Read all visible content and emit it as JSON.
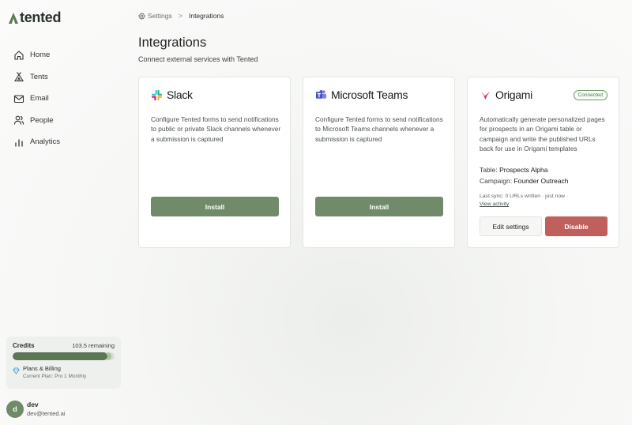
{
  "brand": {
    "name": "tented",
    "color": "#5c7756"
  },
  "nav": [
    {
      "label": "Home",
      "icon": "home-icon"
    },
    {
      "label": "Tents",
      "icon": "tent-icon"
    },
    {
      "label": "Email",
      "icon": "mail-icon"
    },
    {
      "label": "People",
      "icon": "people-icon"
    },
    {
      "label": "Analytics",
      "icon": "analytics-icon"
    }
  ],
  "credits": {
    "title": "Credits",
    "remaining": "103.5 remaining",
    "fill_fraction": 0.93,
    "plans_title": "Plans & Billing",
    "plans_sub": "Current Plan: Pro 1 Monthly"
  },
  "user": {
    "initial": "d",
    "name": "dev",
    "email": "dev@tented.ai"
  },
  "breadcrumb": {
    "parent": "Settings",
    "separator": ">",
    "current": "Integrations"
  },
  "page": {
    "title": "Integrations",
    "subtitle": "Connect external services with Tented"
  },
  "integrations": [
    {
      "name": "Slack",
      "description": "Configure Tented forms to send notifications to public or private Slack channels whenever a submission is captured",
      "install_label": "Install"
    },
    {
      "name": "Microsoft Teams",
      "description": "Configure Tented forms to send notifications to Microsoft Teams channels whenever a submission is captured",
      "install_label": "Install"
    },
    {
      "name": "Origami",
      "status": "Connected",
      "description": "Automatically generate personalized pages for prospects in an Origami table or campaign and write the published URLs back for use in Origami templates",
      "table_label": "Table:",
      "table_value": "Prospects Alpha",
      "campaign_label": "Campaign:",
      "campaign_value": "Founder Outreach",
      "sync_text": "Last sync: 0 URLs written · just now ·",
      "view_activity": "View activity",
      "edit_label": "Edit settings",
      "disable_label": "Disable"
    }
  ],
  "colors": {
    "primary": "#708a6a",
    "danger": "#c0605c",
    "connected": "#4e7a4a"
  }
}
